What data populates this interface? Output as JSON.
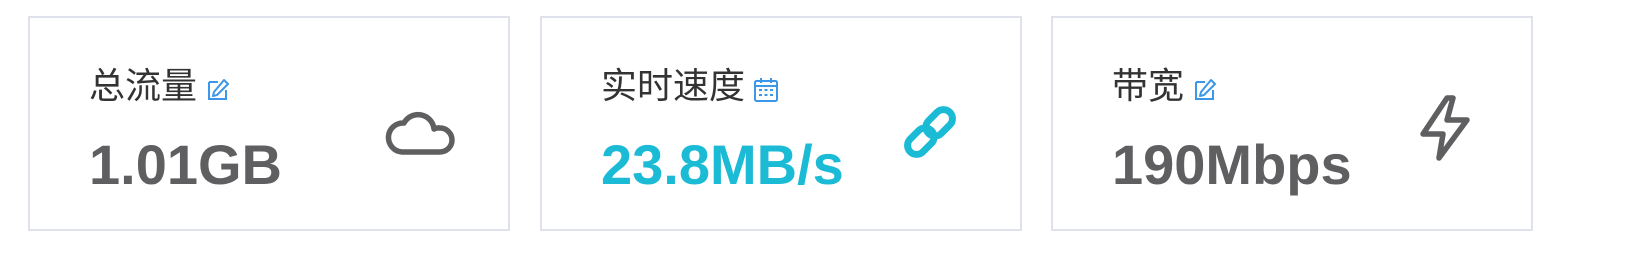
{
  "colors": {
    "value_default": "#5f5f61",
    "value_accent": "#1bbbd6",
    "icon_dark": "#5f5f61",
    "icon_blue": "#3d97e8",
    "card_border": "#dfe1ec"
  },
  "cards": [
    {
      "label": "总流量",
      "label_icon": "edit-icon",
      "value": "1.01GB",
      "icon": "cloud-icon"
    },
    {
      "label": "实时速度",
      "label_icon": "calendar-icon",
      "value": "23.8MB/s",
      "icon": "link-icon"
    },
    {
      "label": "带宽",
      "label_icon": "edit-icon",
      "value": "190Mbps",
      "icon": "lightning-icon"
    }
  ]
}
